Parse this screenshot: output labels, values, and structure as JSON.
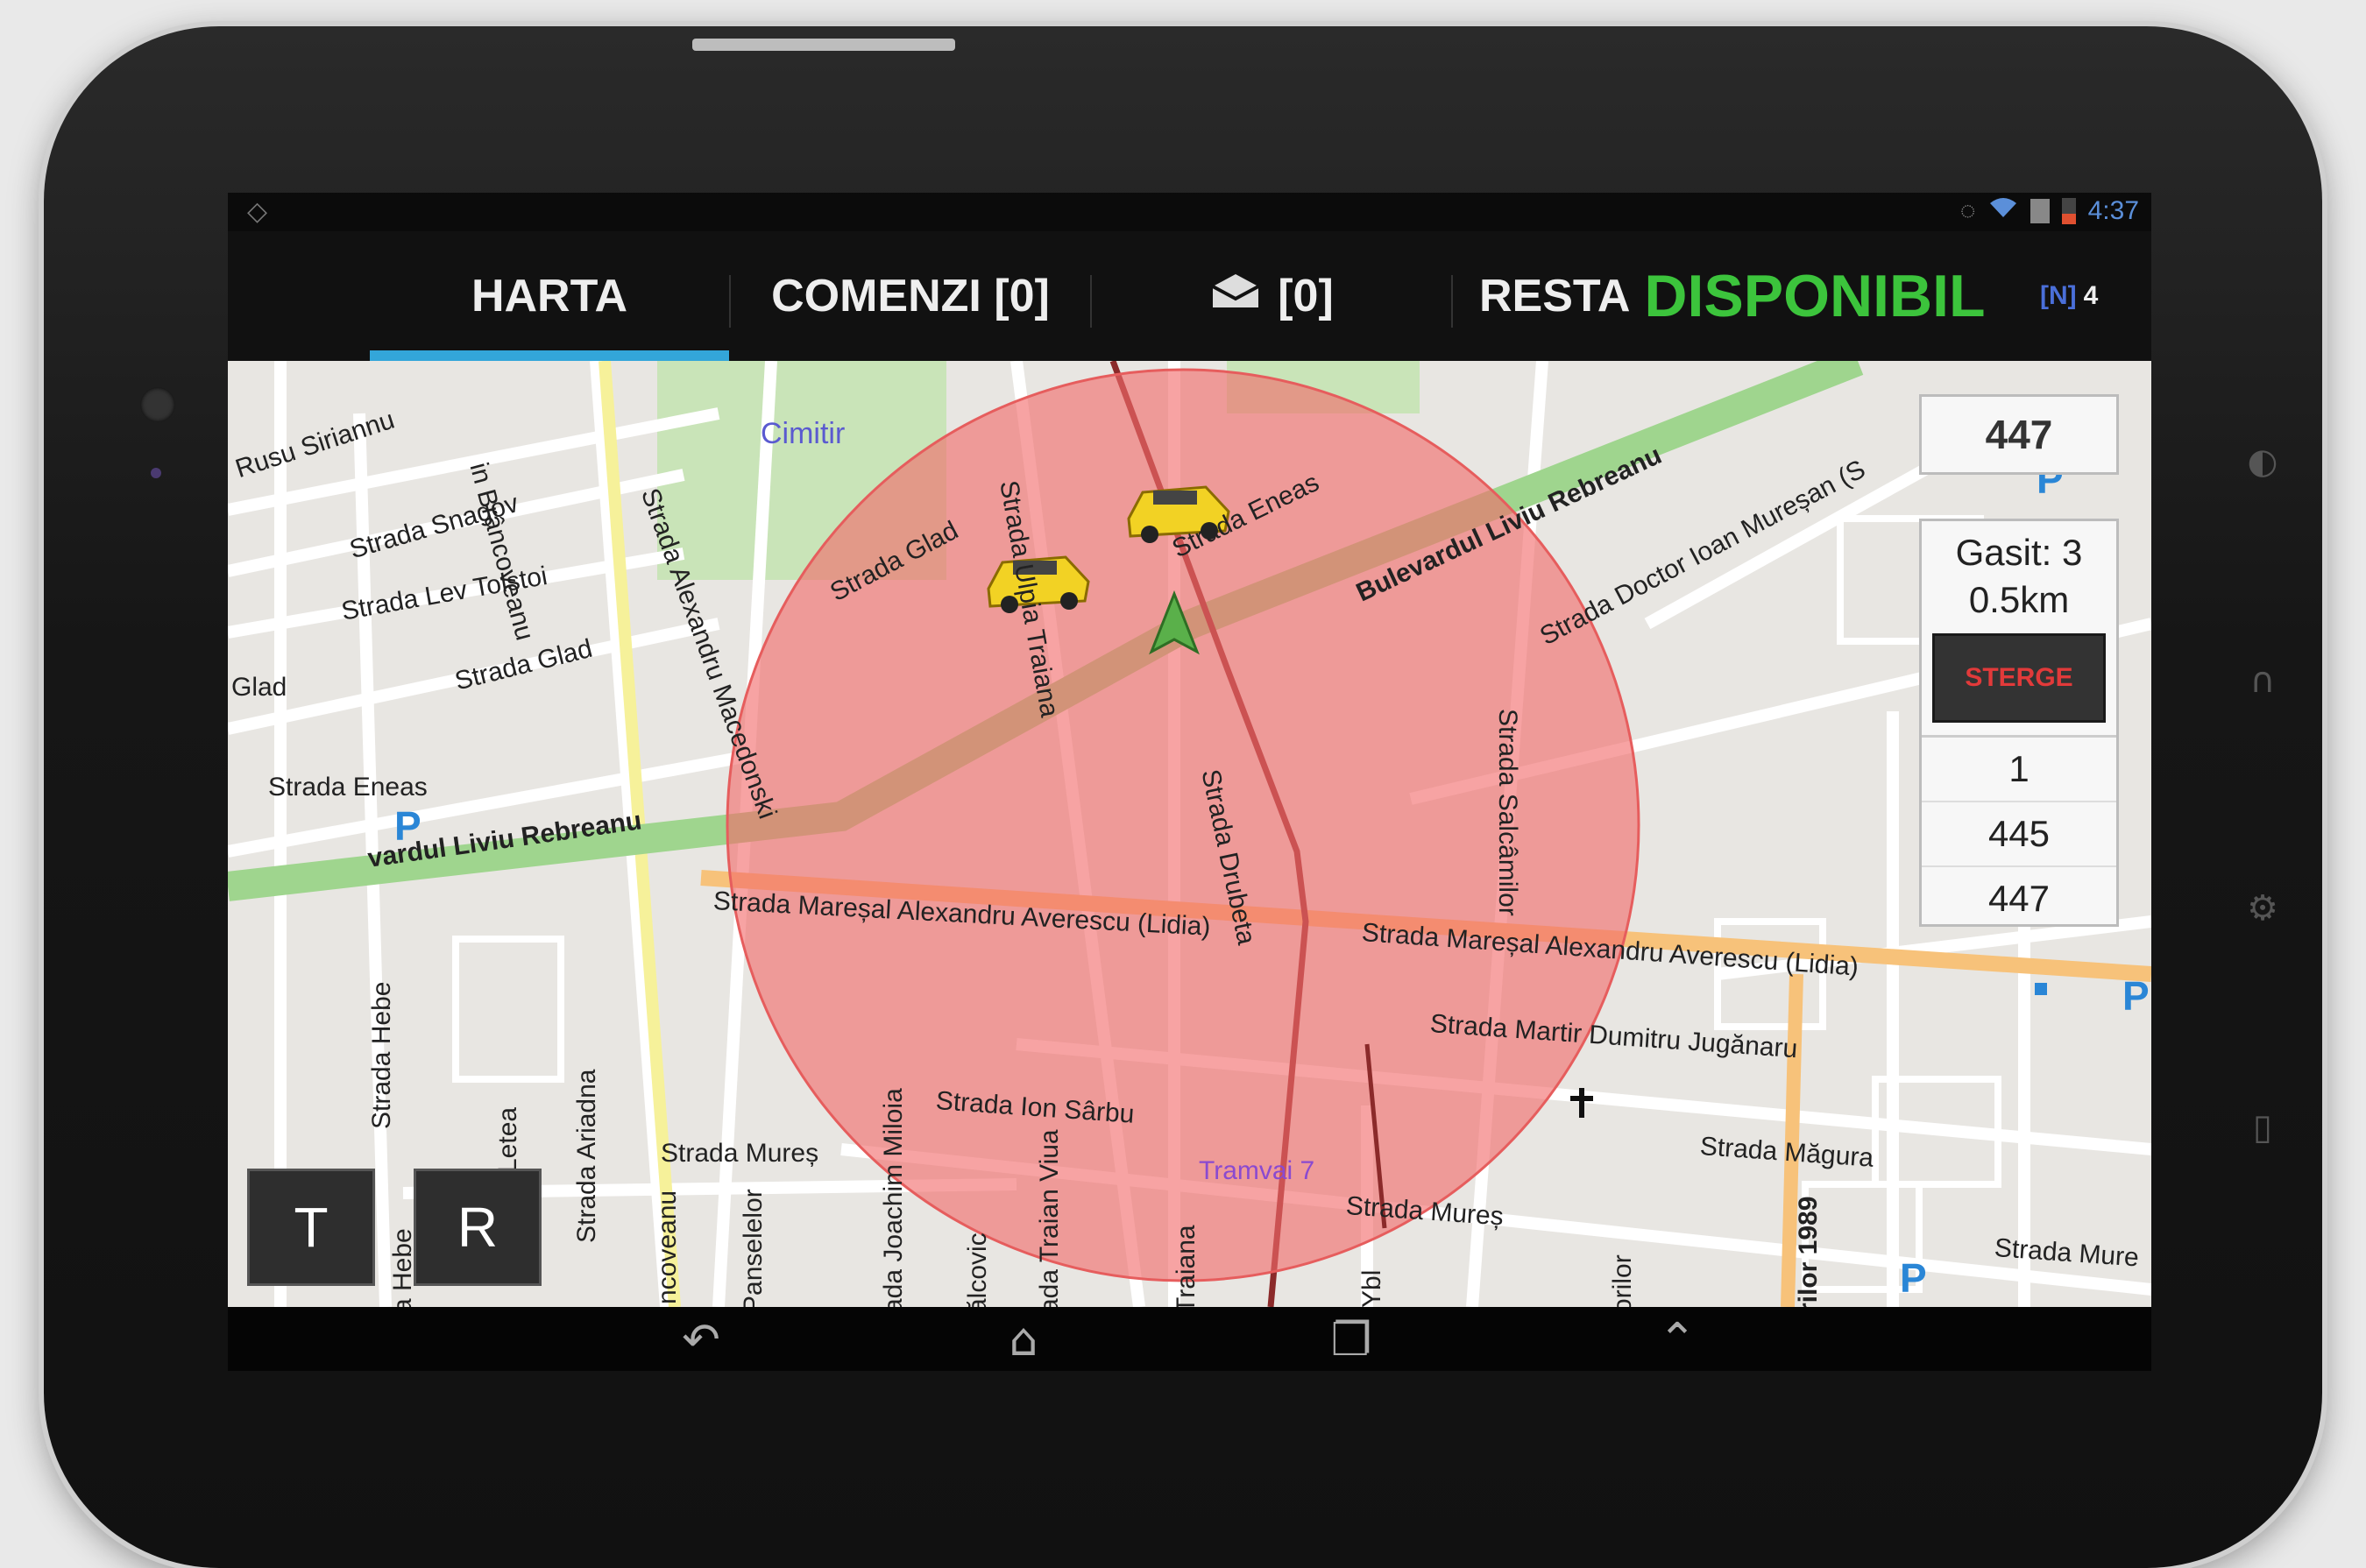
{
  "statusbar": {
    "time": "4:37",
    "left_icon": "◇"
  },
  "tabs": [
    {
      "label": "HARTA"
    },
    {
      "label": "COMENZI [0]"
    },
    {
      "label": "[0]",
      "icon": "inbox-icon"
    }
  ],
  "resta": {
    "label": "RESTA",
    "status": "DISPONIBIL"
  },
  "network": {
    "label": "[N]",
    "count": "4"
  },
  "colors": {
    "accent": "#33a6d9",
    "status_green": "#3cc43c",
    "radius_fill": "#f26b6b",
    "delete_red": "#e23a3a"
  },
  "panel": {
    "id_value": "447",
    "found": "Gasit: 3",
    "distance": "0.5km",
    "delete_label": "STERGE",
    "list": [
      "1",
      "445",
      "447"
    ]
  },
  "buttons": {
    "t_label": "T",
    "r_label": "R"
  },
  "map_labels": {
    "l1": "Rusu Siriannu",
    "l2": "Strada Snagov",
    "l3": "Strada Lev Tolstoi",
    "l4": "Glad",
    "l5": "Strada Glad",
    "l6": "Strada Eneas",
    "l7": "vardul Liviu Rebreanu",
    "l8": "Cimitir",
    "l9": "Strada Glad",
    "l10": "Strada Ulpia Traiana",
    "l11": "Strada Eneas",
    "l12": "Bulevardul Liviu Rebreanu",
    "l13": "Strada Doctor Ioan Mureșan (S",
    "l14": "Strada Alexandru Macedonski",
    "l15": "in Brâncoveanu",
    "l16": "Strada Drubeta",
    "l17": "Strada Salcâmilor",
    "l18": "Strada Mareșal Alexandru Averescu (Lidia)",
    "l19": "Strada Mareșal Alexandru Averescu (Lidia)",
    "l20": "Strada Martir Dumitru Jugănaru",
    "l21": "Strada Ion Sârbu",
    "l22": "Strada Mureș",
    "l23": "Tramvai 7",
    "l24": "Strada Mureș",
    "l25": "Strada Măgura",
    "l26": "Strada Mure",
    "l27": "Strada Hebe",
    "l28": "Letea",
    "l29": "Strada Ariadna",
    "l30": "ncoveanu",
    "l31": "Panselelor",
    "l32": "ada Joachim Miloia",
    "l33": "ălcovic",
    "l34": "ada Traian Viua",
    "l35": "Traiana",
    "l36": "Ybl",
    "l37": "orilor",
    "l38": "rilor 1989",
    "l39": "a Hebe",
    "l40": "89"
  }
}
